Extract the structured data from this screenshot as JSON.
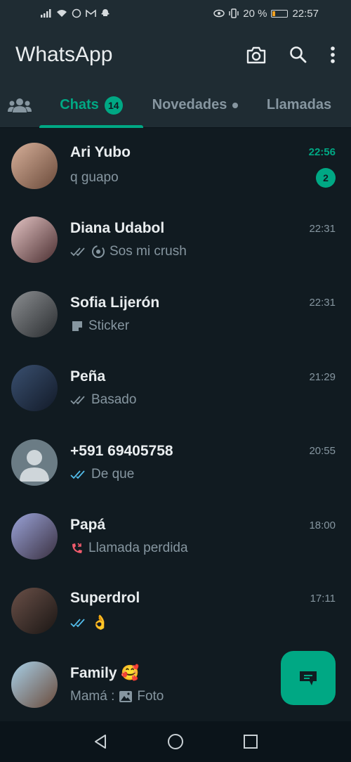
{
  "statusbar": {
    "battery_percent": "20 %",
    "time": "22:57",
    "battery_level": 0.2
  },
  "appbar": {
    "title": "WhatsApp",
    "icons": [
      "camera-icon",
      "search-icon",
      "more-vert-icon"
    ]
  },
  "tabs": {
    "chats_label": "Chats",
    "chats_badge": "14",
    "status_label": "Novedades",
    "calls_label": "Llamadas"
  },
  "chats": [
    {
      "name": "Ari Yubo",
      "time": "22:56",
      "preview": "q guapo",
      "unread": "2",
      "avatar_color": "#8a6a58"
    },
    {
      "name": "Diana Udabol",
      "time": "22:31",
      "preview": "Sos mi crush",
      "avatar_color": "#c9a0a6"
    },
    {
      "name": "Sofia Lijerón",
      "time": "22:31",
      "preview": "Sticker",
      "avatar_color": "#5a5f63"
    },
    {
      "name": "Peña",
      "time": "21:29",
      "preview": "Basado",
      "avatar_color": "#2c3d5a"
    },
    {
      "name": "+591 69405758",
      "time": "20:55",
      "preview": "De que",
      "avatar_color": "#6b7c85"
    },
    {
      "name": "Papá",
      "time": "18:00",
      "preview": "Llamada perdida",
      "avatar_color": "#7c87b8"
    },
    {
      "name": "Superdrol",
      "time": "17:11",
      "preview": "👌",
      "avatar_color": "#4a3a33"
    },
    {
      "name": "Family 🥰",
      "time": "",
      "preview_prefix": "Mamá :",
      "preview": "Foto",
      "avatar_color": "#8a7060"
    }
  ],
  "colors": {
    "accent": "#00a884",
    "background": "#111b21",
    "header": "#1f2c33",
    "read_ticks": "#53bdeb",
    "missed_call": "#f15c6d"
  }
}
